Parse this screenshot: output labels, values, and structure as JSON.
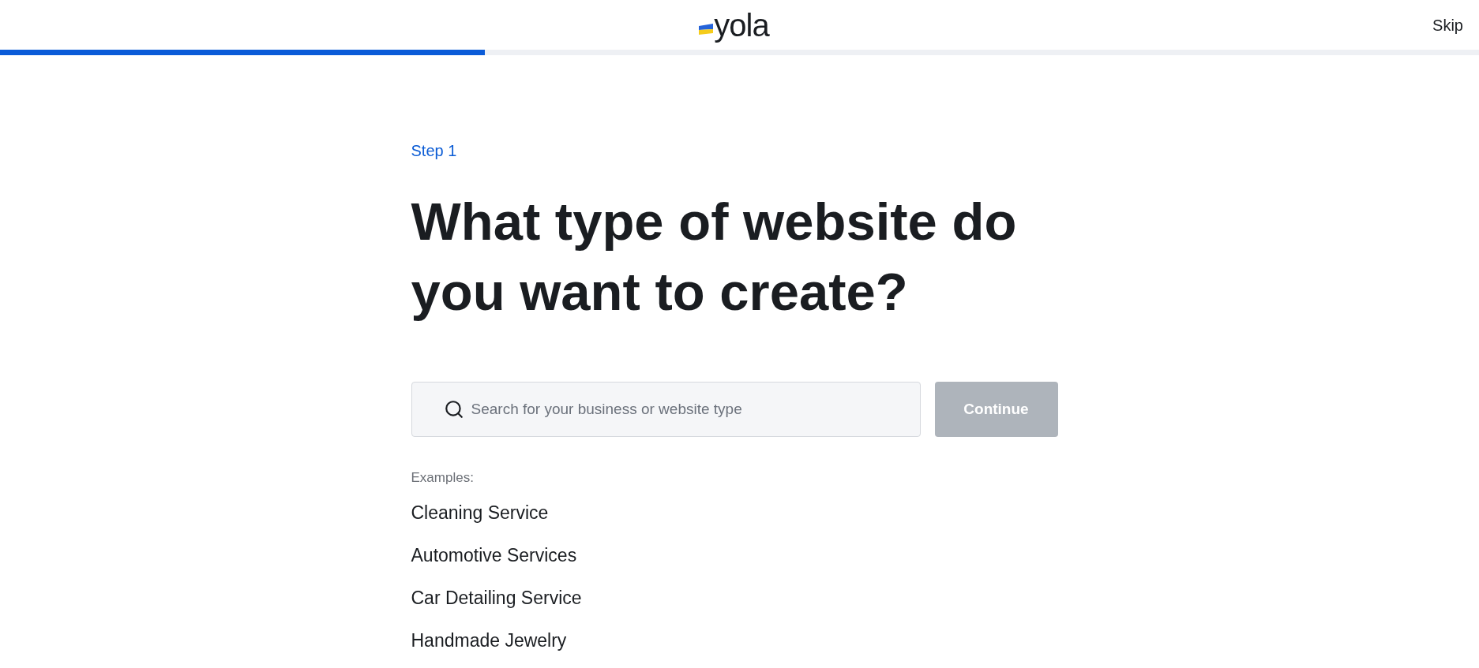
{
  "header": {
    "logo": "yola",
    "skip": "Skip"
  },
  "progress": {
    "level": 0.328
  },
  "step": "Step 1",
  "title": "What type of website do you want to create?",
  "search": {
    "placeholder": "Search for your business or website type"
  },
  "continue_button": {
    "label": "Continue",
    "disabled": true
  },
  "examples": {
    "label": "Examples:",
    "items": [
      "Cleaning Service",
      "Automotive Services",
      "Car Detailing Service",
      "Handmade Jewelry"
    ]
  }
}
